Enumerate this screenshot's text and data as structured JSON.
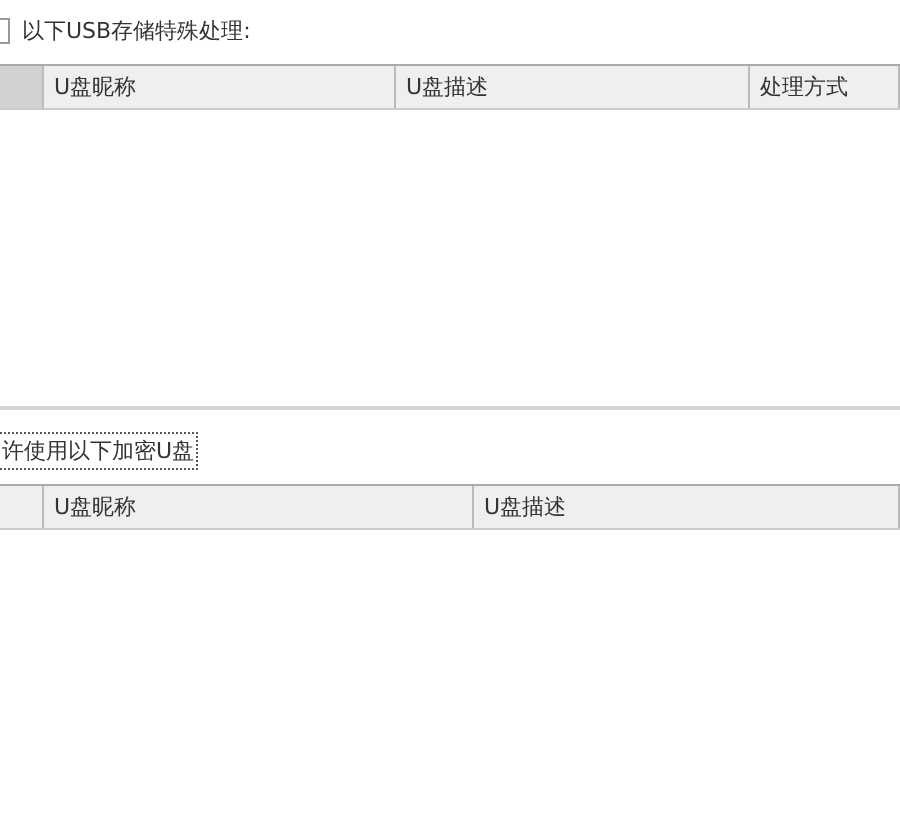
{
  "special_section": {
    "checkbox": {
      "checked": false
    },
    "label": "以下USB存储特殊处理:"
  },
  "special_table": {
    "columns": [
      {
        "sorted": true
      },
      {
        "label": "U盘昵称",
        "sorted": false
      },
      {
        "label": "U盘描述",
        "sorted": false
      },
      {
        "label": "处理方式",
        "sorted": false
      }
    ]
  },
  "encrypted_section": {
    "label": "许使用以下加密U盘",
    "focused": true
  },
  "encrypted_table": {
    "columns": [
      {
        "sorted": false
      },
      {
        "label": "U盘昵称",
        "sorted": false
      },
      {
        "label": "U盘描述",
        "sorted": false
      }
    ]
  }
}
